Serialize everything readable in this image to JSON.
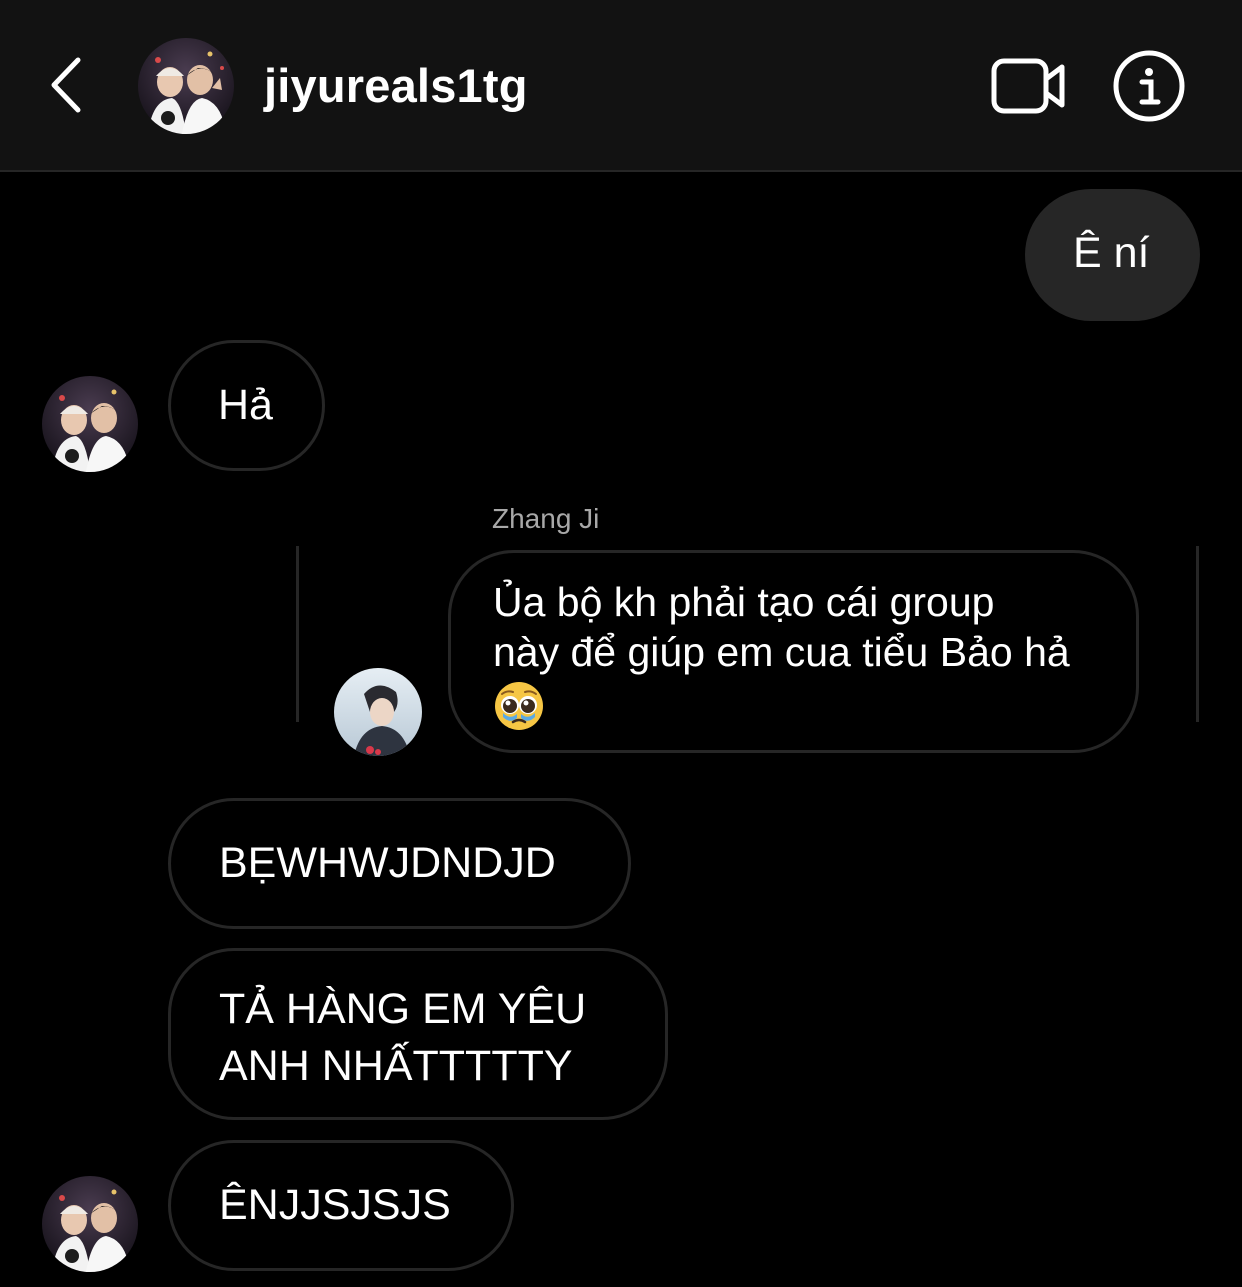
{
  "header": {
    "username": "jiyureals1tg",
    "back_icon": "chevron-left-icon",
    "video_icon": "video-camera-icon",
    "info_icon": "info-icon"
  },
  "messages": [
    {
      "from": "me",
      "text": "Ê ní"
    },
    {
      "from": "them",
      "text": "Hả"
    },
    {
      "from": "shared",
      "author": "Zhang Ji",
      "line1": "Ủa bộ kh phải tạo cái group",
      "line2": "này để giúp em cua tiểu Bảo hả",
      "emoji": "pleading-face-emoji"
    },
    {
      "from": "them",
      "text": "BẸWHWJDNDJD"
    },
    {
      "from": "them",
      "line1": "TẢ HÀNG EM YÊU",
      "line2": "ANH NHẤTTTTTY"
    },
    {
      "from": "them",
      "text": "ÊNJJSJSJS"
    }
  ],
  "colors": {
    "background": "#000000",
    "header": "#121212",
    "outgoing_bubble": "#262626",
    "incoming_border": "#262626",
    "secondary_text": "#a8a8a8"
  }
}
